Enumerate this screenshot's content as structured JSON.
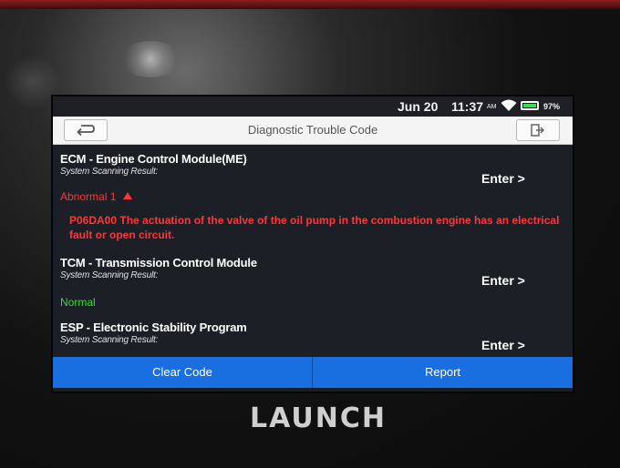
{
  "status": {
    "date": "Jun 20",
    "time": "11:37",
    "am_pm": "AM",
    "battery": "97%",
    "battery_level": 0.97
  },
  "header": {
    "title": "Diagnostic Trouble Code"
  },
  "modules": [
    {
      "name": "ECM - Engine Control Module(ME)",
      "subtitle": "System Scanning Result:",
      "enter_label": "Enter >",
      "result": "Abnormal 1",
      "dtc": "P06DA00 The actuation of the valve of the oil pump in the combustion engine has an electrical fault or open circuit."
    },
    {
      "name": "TCM - Transmission Control Module",
      "subtitle": "System Scanning Result:",
      "enter_label": "Enter >",
      "result": "Normal"
    },
    {
      "name": "ESP - Electronic Stability Program",
      "subtitle": "System Scanning Result:",
      "enter_label": "Enter >"
    }
  ],
  "actions": {
    "clear_code": "Clear Code",
    "report": "Report"
  },
  "device": {
    "brand": "LAUNCH"
  },
  "colors": {
    "abnormal": "#ff3636",
    "normal": "#3ddc3d",
    "button_bar": "#1a6fe0"
  }
}
